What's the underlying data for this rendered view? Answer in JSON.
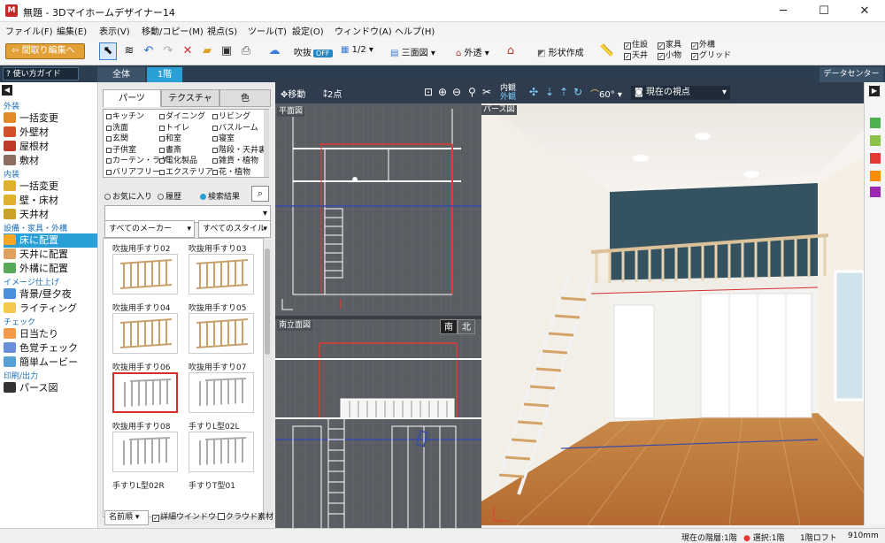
{
  "title": {
    "logo": "M",
    "text": "無題 - 3Dマイホームデザイナー14"
  },
  "menu": [
    "ファイル(F)",
    "編集(E)",
    "表示(V)",
    "移動/コピー(M)",
    "視点(S)",
    "ツール(T)",
    "設定(O)",
    "ウィンドウ(A)",
    "ヘルプ(H)"
  ],
  "toolbar": {
    "back": "間取り編集へ",
    "fukinuke": "吹抜",
    "fukinuke_state": "OFF",
    "ratio": "1/2",
    "view3": "三面図",
    "exterior": "外透",
    "shape": "形状作成",
    "checks": [
      {
        "label": "住設",
        "on": true
      },
      {
        "label": "家具",
        "on": true
      },
      {
        "label": "外構",
        "on": true
      },
      {
        "label": "天井",
        "on": true
      },
      {
        "label": "小物",
        "on": true
      },
      {
        "label": "グリッド",
        "on": true
      }
    ]
  },
  "bar2": {
    "guide": "使い方ガイド",
    "tab_all": "全体",
    "tab_1f": "1階",
    "data_center": "データセンター"
  },
  "nav": [
    {
      "type": "sec",
      "text": "外装"
    },
    {
      "type": "item",
      "text": "一括変更",
      "color": "#e08a2a"
    },
    {
      "type": "item",
      "text": "外壁材",
      "color": "#d4502a"
    },
    {
      "type": "item",
      "text": "屋根材",
      "color": "#c0392b"
    },
    {
      "type": "item",
      "text": "敷材",
      "color": "#8d6e63"
    },
    {
      "type": "sec",
      "text": "内装"
    },
    {
      "type": "item",
      "text": "一括変更",
      "color": "#e0b02a"
    },
    {
      "type": "item",
      "text": "壁・床材",
      "color": "#e0b02a"
    },
    {
      "type": "item",
      "text": "天井材",
      "color": "#c9a227"
    },
    {
      "type": "sec",
      "text": "設備・家具・外構"
    },
    {
      "type": "item",
      "text": "床に配置",
      "color": "#f5a623",
      "sel": true
    },
    {
      "type": "item",
      "text": "天井に配置",
      "color": "#e0a060"
    },
    {
      "type": "item",
      "text": "外構に配置",
      "color": "#5aa85a"
    },
    {
      "type": "sec",
      "text": "イメージ仕上げ"
    },
    {
      "type": "item",
      "text": "背景/昼夕夜",
      "color": "#4a90d9"
    },
    {
      "type": "item",
      "text": "ライティング",
      "color": "#f2c94c"
    },
    {
      "type": "sec",
      "text": "チェック"
    },
    {
      "type": "item",
      "text": "日当たり",
      "color": "#f2994a"
    },
    {
      "type": "item",
      "text": "色覚チェック",
      "color": "#6a8fd9"
    },
    {
      "type": "item",
      "text": "簡単ムービー",
      "color": "#56a0d3"
    },
    {
      "type": "sec",
      "text": "印刷/出力"
    },
    {
      "type": "item",
      "text": "パース図",
      "color": "#333"
    }
  ],
  "panel": {
    "tabs": [
      "パーツ",
      "テクスチャ",
      "色"
    ],
    "cats": [
      [
        "キッチン",
        "ダイニング",
        "リビング"
      ],
      [
        "洗面",
        "トイレ",
        "バスルーム"
      ],
      [
        "玄関",
        "和室",
        "寝室"
      ],
      [
        "子供室",
        "書斎",
        "階段・天井裏"
      ],
      [
        "カーテン・ラグ",
        "電化製品",
        "雑貨・植物"
      ],
      [
        "バリアフリー",
        "エクステリア",
        "花・植物"
      ]
    ],
    "radios": [
      "お気に入り",
      "履歴",
      "検索結果"
    ],
    "maker": "すべてのメーカー",
    "style": "すべてのスタイル",
    "thumbs": [
      "吹抜用手すり02",
      "吹抜用手すり03",
      "吹抜用手すり04",
      "吹抜用手すり05",
      "吹抜用手すり06",
      "吹抜用手すり07",
      "吹抜用手すり08",
      "手すりL型02L",
      "手すりL型02R",
      "手すりT型01"
    ],
    "sort": "名前順",
    "detail": "詳細ウインドウ",
    "cloud": "クラウド素材"
  },
  "views": {
    "move": "移動",
    "twopoint": "2点",
    "plan": "平面図",
    "elev": "南立面図",
    "south": "南",
    "north": "北",
    "persp": "パース図",
    "inner": "内観",
    "outer": "外観",
    "angle": "60°",
    "viewpoint": "現在の視点"
  },
  "status": {
    "floor": "現在の階層:1階",
    "select": "選択:1階",
    "loft": "1階ロフト",
    "size": "910mm"
  }
}
